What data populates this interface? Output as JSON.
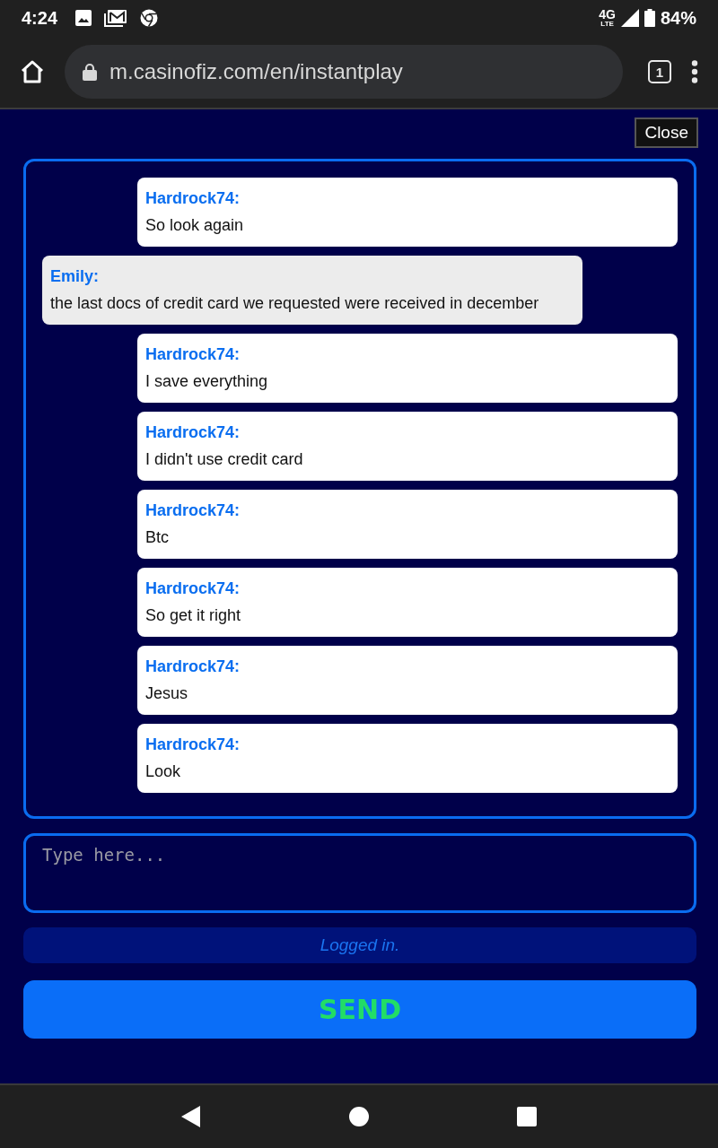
{
  "status_bar": {
    "time": "4:24",
    "network": "4G",
    "network_sub": "LTE",
    "battery": "84%"
  },
  "browser": {
    "url": "m.casinofiz.com/en/instantplay",
    "tab_count": "1"
  },
  "chat": {
    "close_label": "Close",
    "messages": [
      {
        "kind": "user",
        "author": "Hardrock74:",
        "text": "So look again"
      },
      {
        "kind": "agent",
        "author": "Emily:",
        "text": "the last docs of credit card we requested were received in december"
      },
      {
        "kind": "user",
        "author": "Hardrock74:",
        "text": "I save everything"
      },
      {
        "kind": "user",
        "author": "Hardrock74:",
        "text": "I didn't use credit card"
      },
      {
        "kind": "user",
        "author": "Hardrock74:",
        "text": "Btc"
      },
      {
        "kind": "user",
        "author": "Hardrock74:",
        "text": "So get it right"
      },
      {
        "kind": "user",
        "author": "Hardrock74:",
        "text": "Jesus"
      },
      {
        "kind": "user",
        "author": "Hardrock74:",
        "text": "Look"
      }
    ],
    "input": {
      "placeholder": "Type here..."
    },
    "status": "Logged in.",
    "send_label": "SEND"
  }
}
